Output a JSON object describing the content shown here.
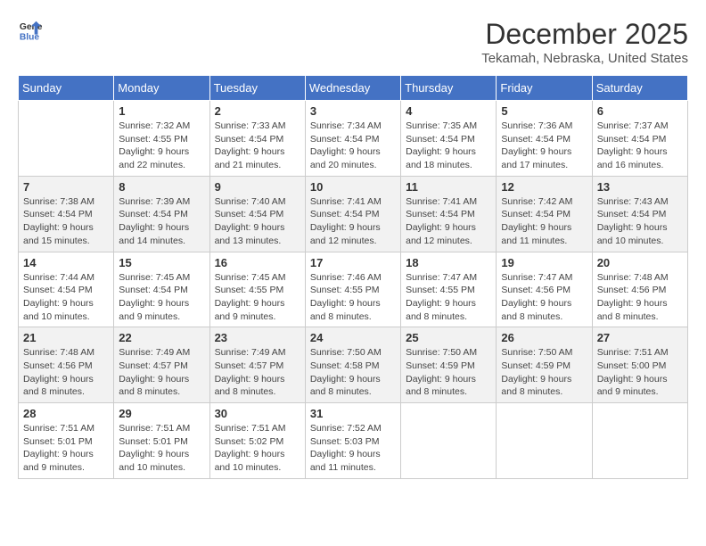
{
  "header": {
    "logo_general": "General",
    "logo_blue": "Blue",
    "month": "December 2025",
    "location": "Tekamah, Nebraska, United States"
  },
  "weekdays": [
    "Sunday",
    "Monday",
    "Tuesday",
    "Wednesday",
    "Thursday",
    "Friday",
    "Saturday"
  ],
  "weeks": [
    [
      {
        "day": "",
        "info": ""
      },
      {
        "day": "1",
        "info": "Sunrise: 7:32 AM\nSunset: 4:55 PM\nDaylight: 9 hours and 22 minutes."
      },
      {
        "day": "2",
        "info": "Sunrise: 7:33 AM\nSunset: 4:54 PM\nDaylight: 9 hours and 21 minutes."
      },
      {
        "day": "3",
        "info": "Sunrise: 7:34 AM\nSunset: 4:54 PM\nDaylight: 9 hours and 20 minutes."
      },
      {
        "day": "4",
        "info": "Sunrise: 7:35 AM\nSunset: 4:54 PM\nDaylight: 9 hours and 18 minutes."
      },
      {
        "day": "5",
        "info": "Sunrise: 7:36 AM\nSunset: 4:54 PM\nDaylight: 9 hours and 17 minutes."
      },
      {
        "day": "6",
        "info": "Sunrise: 7:37 AM\nSunset: 4:54 PM\nDaylight: 9 hours and 16 minutes."
      }
    ],
    [
      {
        "day": "7",
        "info": "Sunrise: 7:38 AM\nSunset: 4:54 PM\nDaylight: 9 hours and 15 minutes."
      },
      {
        "day": "8",
        "info": "Sunrise: 7:39 AM\nSunset: 4:54 PM\nDaylight: 9 hours and 14 minutes."
      },
      {
        "day": "9",
        "info": "Sunrise: 7:40 AM\nSunset: 4:54 PM\nDaylight: 9 hours and 13 minutes."
      },
      {
        "day": "10",
        "info": "Sunrise: 7:41 AM\nSunset: 4:54 PM\nDaylight: 9 hours and 12 minutes."
      },
      {
        "day": "11",
        "info": "Sunrise: 7:41 AM\nSunset: 4:54 PM\nDaylight: 9 hours and 12 minutes."
      },
      {
        "day": "12",
        "info": "Sunrise: 7:42 AM\nSunset: 4:54 PM\nDaylight: 9 hours and 11 minutes."
      },
      {
        "day": "13",
        "info": "Sunrise: 7:43 AM\nSunset: 4:54 PM\nDaylight: 9 hours and 10 minutes."
      }
    ],
    [
      {
        "day": "14",
        "info": "Sunrise: 7:44 AM\nSunset: 4:54 PM\nDaylight: 9 hours and 10 minutes."
      },
      {
        "day": "15",
        "info": "Sunrise: 7:45 AM\nSunset: 4:54 PM\nDaylight: 9 hours and 9 minutes."
      },
      {
        "day": "16",
        "info": "Sunrise: 7:45 AM\nSunset: 4:55 PM\nDaylight: 9 hours and 9 minutes."
      },
      {
        "day": "17",
        "info": "Sunrise: 7:46 AM\nSunset: 4:55 PM\nDaylight: 9 hours and 8 minutes."
      },
      {
        "day": "18",
        "info": "Sunrise: 7:47 AM\nSunset: 4:55 PM\nDaylight: 9 hours and 8 minutes."
      },
      {
        "day": "19",
        "info": "Sunrise: 7:47 AM\nSunset: 4:56 PM\nDaylight: 9 hours and 8 minutes."
      },
      {
        "day": "20",
        "info": "Sunrise: 7:48 AM\nSunset: 4:56 PM\nDaylight: 9 hours and 8 minutes."
      }
    ],
    [
      {
        "day": "21",
        "info": "Sunrise: 7:48 AM\nSunset: 4:56 PM\nDaylight: 9 hours and 8 minutes."
      },
      {
        "day": "22",
        "info": "Sunrise: 7:49 AM\nSunset: 4:57 PM\nDaylight: 9 hours and 8 minutes."
      },
      {
        "day": "23",
        "info": "Sunrise: 7:49 AM\nSunset: 4:57 PM\nDaylight: 9 hours and 8 minutes."
      },
      {
        "day": "24",
        "info": "Sunrise: 7:50 AM\nSunset: 4:58 PM\nDaylight: 9 hours and 8 minutes."
      },
      {
        "day": "25",
        "info": "Sunrise: 7:50 AM\nSunset: 4:59 PM\nDaylight: 9 hours and 8 minutes."
      },
      {
        "day": "26",
        "info": "Sunrise: 7:50 AM\nSunset: 4:59 PM\nDaylight: 9 hours and 8 minutes."
      },
      {
        "day": "27",
        "info": "Sunrise: 7:51 AM\nSunset: 5:00 PM\nDaylight: 9 hours and 9 minutes."
      }
    ],
    [
      {
        "day": "28",
        "info": "Sunrise: 7:51 AM\nSunset: 5:01 PM\nDaylight: 9 hours and 9 minutes."
      },
      {
        "day": "29",
        "info": "Sunrise: 7:51 AM\nSunset: 5:01 PM\nDaylight: 9 hours and 10 minutes."
      },
      {
        "day": "30",
        "info": "Sunrise: 7:51 AM\nSunset: 5:02 PM\nDaylight: 9 hours and 10 minutes."
      },
      {
        "day": "31",
        "info": "Sunrise: 7:52 AM\nSunset: 5:03 PM\nDaylight: 9 hours and 11 minutes."
      },
      {
        "day": "",
        "info": ""
      },
      {
        "day": "",
        "info": ""
      },
      {
        "day": "",
        "info": ""
      }
    ]
  ]
}
